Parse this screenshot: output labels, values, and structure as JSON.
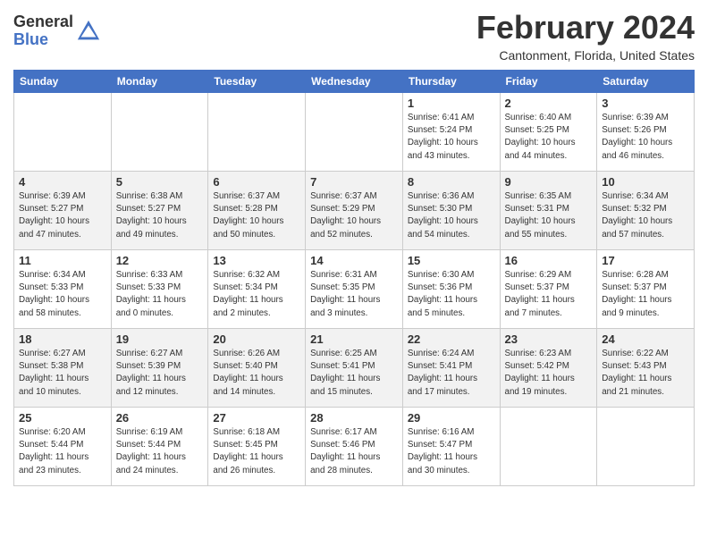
{
  "logo": {
    "general": "General",
    "blue": "Blue"
  },
  "title": {
    "month_year": "February 2024",
    "location": "Cantonment, Florida, United States"
  },
  "weekdays": [
    "Sunday",
    "Monday",
    "Tuesday",
    "Wednesday",
    "Thursday",
    "Friday",
    "Saturday"
  ],
  "weeks": [
    [
      {
        "day": "",
        "info": ""
      },
      {
        "day": "",
        "info": ""
      },
      {
        "day": "",
        "info": ""
      },
      {
        "day": "",
        "info": ""
      },
      {
        "day": "1",
        "info": "Sunrise: 6:41 AM\nSunset: 5:24 PM\nDaylight: 10 hours\nand 43 minutes."
      },
      {
        "day": "2",
        "info": "Sunrise: 6:40 AM\nSunset: 5:25 PM\nDaylight: 10 hours\nand 44 minutes."
      },
      {
        "day": "3",
        "info": "Sunrise: 6:39 AM\nSunset: 5:26 PM\nDaylight: 10 hours\nand 46 minutes."
      }
    ],
    [
      {
        "day": "4",
        "info": "Sunrise: 6:39 AM\nSunset: 5:27 PM\nDaylight: 10 hours\nand 47 minutes."
      },
      {
        "day": "5",
        "info": "Sunrise: 6:38 AM\nSunset: 5:27 PM\nDaylight: 10 hours\nand 49 minutes."
      },
      {
        "day": "6",
        "info": "Sunrise: 6:37 AM\nSunset: 5:28 PM\nDaylight: 10 hours\nand 50 minutes."
      },
      {
        "day": "7",
        "info": "Sunrise: 6:37 AM\nSunset: 5:29 PM\nDaylight: 10 hours\nand 52 minutes."
      },
      {
        "day": "8",
        "info": "Sunrise: 6:36 AM\nSunset: 5:30 PM\nDaylight: 10 hours\nand 54 minutes."
      },
      {
        "day": "9",
        "info": "Sunrise: 6:35 AM\nSunset: 5:31 PM\nDaylight: 10 hours\nand 55 minutes."
      },
      {
        "day": "10",
        "info": "Sunrise: 6:34 AM\nSunset: 5:32 PM\nDaylight: 10 hours\nand 57 minutes."
      }
    ],
    [
      {
        "day": "11",
        "info": "Sunrise: 6:34 AM\nSunset: 5:33 PM\nDaylight: 10 hours\nand 58 minutes."
      },
      {
        "day": "12",
        "info": "Sunrise: 6:33 AM\nSunset: 5:33 PM\nDaylight: 11 hours\nand 0 minutes."
      },
      {
        "day": "13",
        "info": "Sunrise: 6:32 AM\nSunset: 5:34 PM\nDaylight: 11 hours\nand 2 minutes."
      },
      {
        "day": "14",
        "info": "Sunrise: 6:31 AM\nSunset: 5:35 PM\nDaylight: 11 hours\nand 3 minutes."
      },
      {
        "day": "15",
        "info": "Sunrise: 6:30 AM\nSunset: 5:36 PM\nDaylight: 11 hours\nand 5 minutes."
      },
      {
        "day": "16",
        "info": "Sunrise: 6:29 AM\nSunset: 5:37 PM\nDaylight: 11 hours\nand 7 minutes."
      },
      {
        "day": "17",
        "info": "Sunrise: 6:28 AM\nSunset: 5:37 PM\nDaylight: 11 hours\nand 9 minutes."
      }
    ],
    [
      {
        "day": "18",
        "info": "Sunrise: 6:27 AM\nSunset: 5:38 PM\nDaylight: 11 hours\nand 10 minutes."
      },
      {
        "day": "19",
        "info": "Sunrise: 6:27 AM\nSunset: 5:39 PM\nDaylight: 11 hours\nand 12 minutes."
      },
      {
        "day": "20",
        "info": "Sunrise: 6:26 AM\nSunset: 5:40 PM\nDaylight: 11 hours\nand 14 minutes."
      },
      {
        "day": "21",
        "info": "Sunrise: 6:25 AM\nSunset: 5:41 PM\nDaylight: 11 hours\nand 15 minutes."
      },
      {
        "day": "22",
        "info": "Sunrise: 6:24 AM\nSunset: 5:41 PM\nDaylight: 11 hours\nand 17 minutes."
      },
      {
        "day": "23",
        "info": "Sunrise: 6:23 AM\nSunset: 5:42 PM\nDaylight: 11 hours\nand 19 minutes."
      },
      {
        "day": "24",
        "info": "Sunrise: 6:22 AM\nSunset: 5:43 PM\nDaylight: 11 hours\nand 21 minutes."
      }
    ],
    [
      {
        "day": "25",
        "info": "Sunrise: 6:20 AM\nSunset: 5:44 PM\nDaylight: 11 hours\nand 23 minutes."
      },
      {
        "day": "26",
        "info": "Sunrise: 6:19 AM\nSunset: 5:44 PM\nDaylight: 11 hours\nand 24 minutes."
      },
      {
        "day": "27",
        "info": "Sunrise: 6:18 AM\nSunset: 5:45 PM\nDaylight: 11 hours\nand 26 minutes."
      },
      {
        "day": "28",
        "info": "Sunrise: 6:17 AM\nSunset: 5:46 PM\nDaylight: 11 hours\nand 28 minutes."
      },
      {
        "day": "29",
        "info": "Sunrise: 6:16 AM\nSunset: 5:47 PM\nDaylight: 11 hours\nand 30 minutes."
      },
      {
        "day": "",
        "info": ""
      },
      {
        "day": "",
        "info": ""
      }
    ]
  ]
}
